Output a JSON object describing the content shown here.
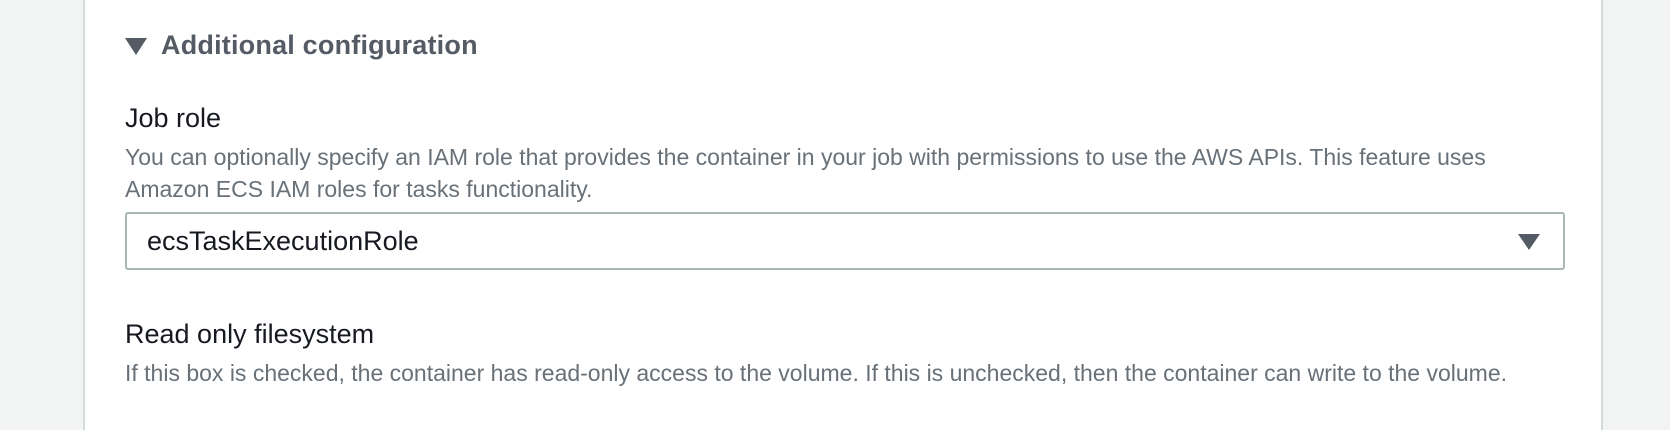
{
  "section": {
    "title": "Additional configuration",
    "toggle_icon": "caret-down-icon"
  },
  "job_role": {
    "label": "Job role",
    "description": "You can optionally specify an IAM role that provides the container in your job with permissions to use the AWS APIs. This feature uses Amazon ECS IAM roles for tasks functionality.",
    "selected_value": "ecsTaskExecutionRole",
    "dropdown_icon": "caret-down-icon"
  },
  "read_only_filesystem": {
    "label": "Read only filesystem",
    "description": "If this box is checked, the container has read-only access to the volume. If this is unchecked, then the container can write to the volume."
  },
  "colors": {
    "page_background": "#f2f3f3",
    "heading_text": "#545b64",
    "label_text": "#16191f",
    "description_text": "#687078",
    "select_border": "#aab7b8"
  }
}
